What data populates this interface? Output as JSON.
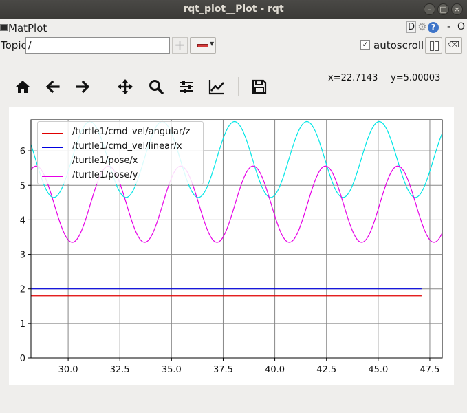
{
  "window": {
    "title": "rqt_plot__Plot - rqt"
  },
  "plugin": {
    "title": "MatPlot",
    "d_button": "D",
    "help_button": "?",
    "dash_button": "-",
    "close_button": "O"
  },
  "topic": {
    "label": "Topic",
    "value": "/",
    "add_label": "+"
  },
  "autoscroll": {
    "label": "autoscroll",
    "checked": true,
    "check_mark": "✓"
  },
  "toolbar": {
    "tools": [
      "home-icon",
      "back-arrow-icon",
      "forward-arrow-icon",
      "pan-move-icon",
      "zoom-icon",
      "configure-subplots-icon",
      "edit-curves-icon",
      "save-icon"
    ]
  },
  "cursor": {
    "x_text": "x=22.7143",
    "y_text": "y=5.00003"
  },
  "colors": {
    "angular": "#e00000",
    "linear": "#0000e0",
    "pose_x": "#00e6e6",
    "pose_y": "#e600e6",
    "grid": "#888888"
  },
  "chart_data": {
    "type": "line",
    "title": "",
    "xlabel": "",
    "ylabel": "",
    "xlim": [
      28.2,
      48.1
    ],
    "ylim": [
      0,
      6.9
    ],
    "xticks": [
      30.0,
      32.5,
      35.0,
      37.5,
      40.0,
      42.5,
      45.0,
      47.5
    ],
    "xtick_labels": [
      "30.0",
      "32.5",
      "35.0",
      "37.5",
      "40.0",
      "42.5",
      "45.0",
      "47.5"
    ],
    "yticks": [
      0,
      1,
      2,
      3,
      4,
      5,
      6
    ],
    "ytick_labels": [
      "0",
      "1",
      "2",
      "3",
      "4",
      "5",
      "6"
    ],
    "grid": true,
    "legend_position": "top-left",
    "series": [
      {
        "name": "/turtle1/cmd_vel/angular/z",
        "color": "#e00000",
        "kind": "constant",
        "value": 1.8,
        "x_start": 28.2,
        "x_end": 47.1
      },
      {
        "name": "/turtle1/cmd_vel/linear/x",
        "color": "#0000e0",
        "kind": "constant",
        "value": 2.0,
        "x_start": 28.2,
        "x_end": 47.1
      },
      {
        "name": "/turtle1/pose/x",
        "color": "#00e6e6",
        "kind": "sine",
        "mean": 5.75,
        "amplitude": 1.1,
        "period": 3.5,
        "peak_x": 38.05,
        "x_start": 28.2,
        "x_end": 48.1
      },
      {
        "name": "/turtle1/pose/y",
        "color": "#e600e6",
        "kind": "sine",
        "mean": 4.455,
        "amplitude": 1.105,
        "period": 3.5,
        "peak_x": 35.45,
        "x_start": 28.2,
        "x_end": 48.1
      }
    ]
  }
}
